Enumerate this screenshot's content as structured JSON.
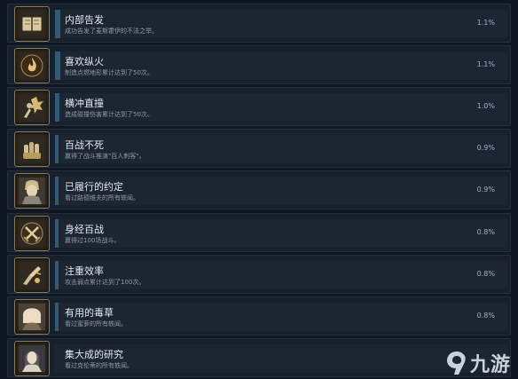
{
  "achievements": [
    {
      "title": "内部告发",
      "description": "成功告发了麦斯霍伊的不法之举。",
      "percent": "1.1%",
      "icon": "book-icon",
      "progress": 1.1
    },
    {
      "title": "喜欢纵火",
      "description": "制造点燃地形累计达到了50次。",
      "percent": "1.1%",
      "icon": "flame-icon",
      "progress": 1.1
    },
    {
      "title": "横冲直撞",
      "description": "造成碰撞伤害累计达到了50次。",
      "percent": "1.0%",
      "icon": "collision-icon",
      "progress": 1.0
    },
    {
      "title": "百战不死",
      "description": "赢得了战斗推演\"百人刺客\"。",
      "percent": "0.9%",
      "icon": "fist-icon",
      "progress": 0.9
    },
    {
      "title": "已履行的约定",
      "description": "看过路德维夫的所有轶闻。",
      "percent": "0.9%",
      "icon": "knight-portrait-icon",
      "progress": 0.9
    },
    {
      "title": "身经百战",
      "description": "赢得过100场战斗。",
      "percent": "0.8%",
      "icon": "crossed-swords-icon",
      "progress": 0.8
    },
    {
      "title": "注重效率",
      "description": "攻击弱点累计达到了100次。",
      "percent": "0.8%",
      "icon": "target-strike-icon",
      "progress": 0.8
    },
    {
      "title": "有用的毒草",
      "description": "看过蜜萝的所有轶闻。",
      "percent": "0.8%",
      "icon": "girl-portrait-icon",
      "progress": 0.8
    },
    {
      "title": "集大成的研究",
      "description": "看过克伦蒂的所有轶闻。",
      "percent": "",
      "icon": "scholar-portrait-icon",
      "progress": 0
    }
  ],
  "watermark": {
    "text": "九游"
  }
}
